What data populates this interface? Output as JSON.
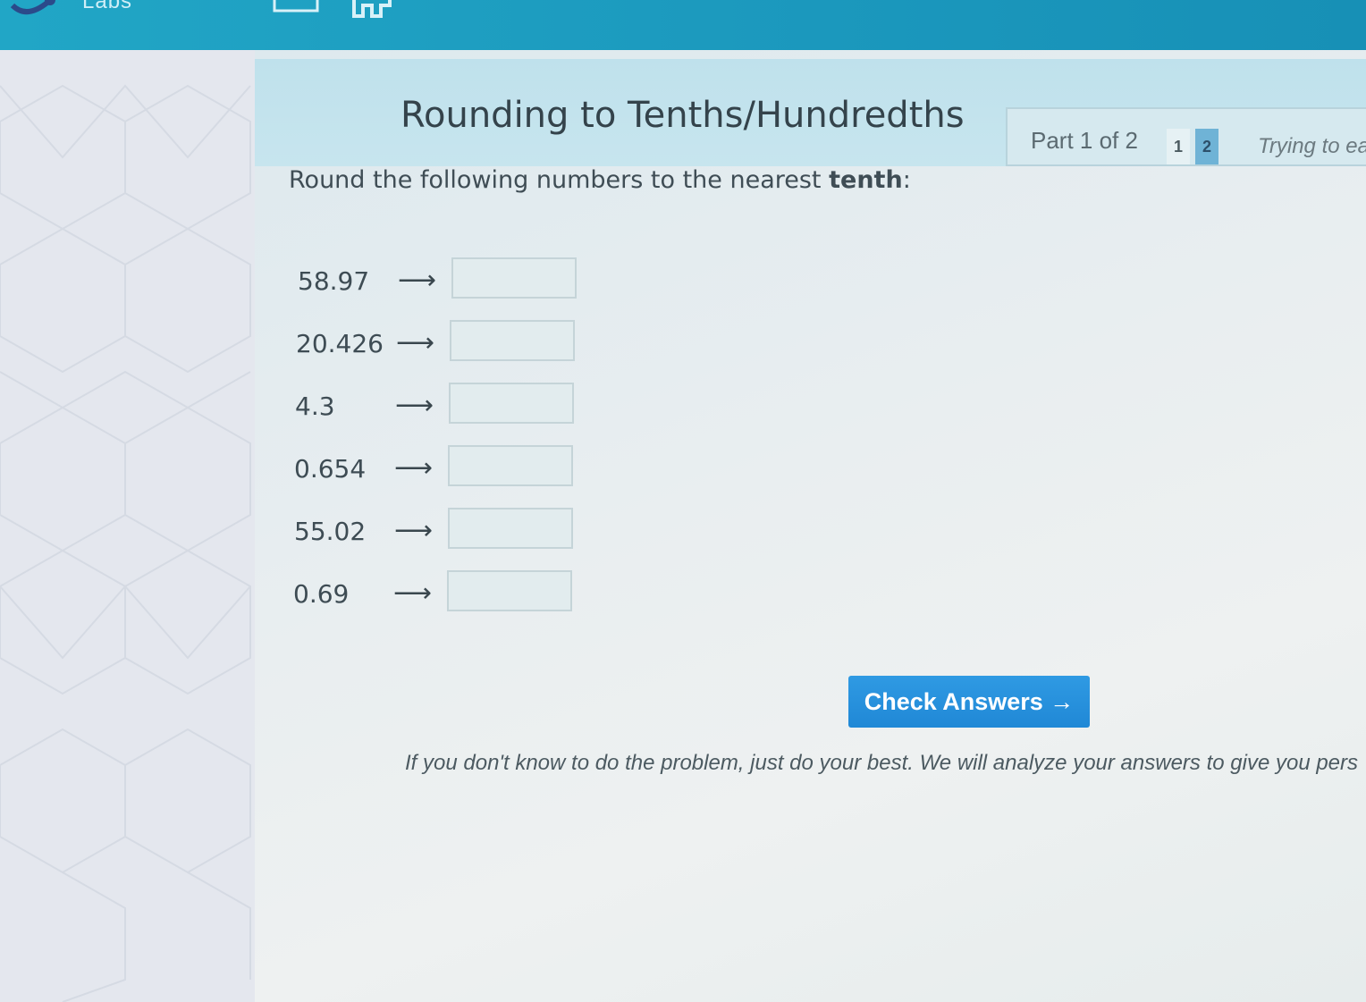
{
  "app": {
    "logo_text": "Labs"
  },
  "header": {
    "title": "Rounding to Tenths/Hundredths",
    "part_label": "Part 1 of 2",
    "part_buttons": [
      "1",
      "2"
    ],
    "status_text": "Trying to ea"
  },
  "instruction": {
    "prefix": "Round the following numbers to the nearest ",
    "emphasis": "tenth",
    "suffix": ":"
  },
  "problems": [
    {
      "number": "58.97",
      "arrow": "⟶",
      "answer": ""
    },
    {
      "number": "20.426",
      "arrow": "⟶",
      "answer": ""
    },
    {
      "number": "4.3",
      "arrow": "⟶",
      "answer": ""
    },
    {
      "number": "0.654",
      "arrow": "⟶",
      "answer": ""
    },
    {
      "number": "55.02",
      "arrow": "⟶",
      "answer": ""
    },
    {
      "number": "0.69",
      "arrow": "⟶",
      "answer": ""
    }
  ],
  "check_button": "Check Answers →",
  "hint": "If you don't know to do the problem, just do your best. We will analyze your answers to give you pers",
  "colors": {
    "topbar": "#21a6c6",
    "button": "#2088d6",
    "active_part": "#6fb3d6"
  }
}
